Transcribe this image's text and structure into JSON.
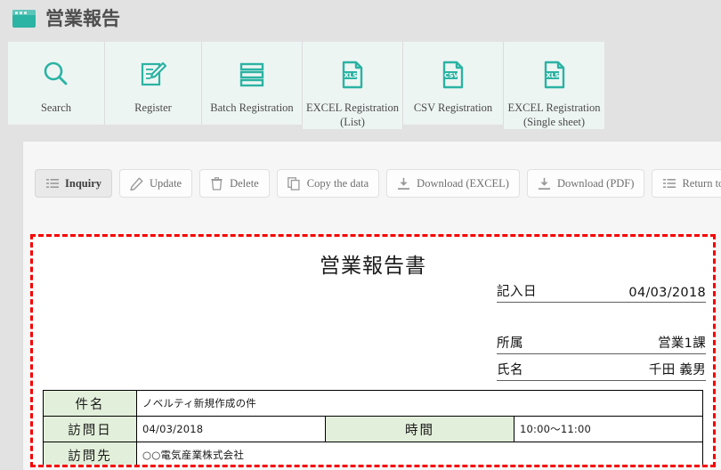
{
  "header": {
    "title": "営業報告",
    "logo_icon": "window-icon",
    "accent_color": "#2bb3a3"
  },
  "tabs": [
    {
      "id": "search",
      "label": "Search",
      "icon": "magnifier-icon",
      "active": false
    },
    {
      "id": "register",
      "label": "Register",
      "icon": "pencil-document-icon",
      "active": false
    },
    {
      "id": "batch-registration",
      "label": "Batch Registration",
      "icon": "stacked-rows-icon",
      "active": false
    },
    {
      "id": "excel-registration-list",
      "label": "EXCEL Registration\n(List)",
      "icon": "xls-file-icon",
      "active": true
    },
    {
      "id": "csv-registration",
      "label": "CSV Registration",
      "icon": "csv-file-icon",
      "active": false
    },
    {
      "id": "excel-registration-single",
      "label": "EXCEL Registration\n(Single sheet)",
      "icon": "xls-file-icon",
      "active": true
    }
  ],
  "actions": [
    {
      "id": "inquiry",
      "label": "Inquiry",
      "icon": "list-icon",
      "active": true
    },
    {
      "id": "update",
      "label": "Update",
      "icon": "pencil-icon",
      "active": false
    },
    {
      "id": "delete",
      "label": "Delete",
      "icon": "trash-icon",
      "active": false
    },
    {
      "id": "copy-the-data",
      "label": "Copy the data",
      "icon": "copy-icon",
      "active": false
    },
    {
      "id": "download-excel",
      "label": "Download (EXCEL)",
      "icon": "download-icon",
      "active": false
    },
    {
      "id": "download-pdf",
      "label": "Download (PDF)",
      "icon": "download-icon",
      "active": false
    },
    {
      "id": "return-to-list",
      "label": "Return to list",
      "icon": "list-icon",
      "active": false
    }
  ],
  "report": {
    "border_color": "#f60000",
    "title": "営業報告書",
    "meta": {
      "date_label": "記入日",
      "date_value": "04/03/2018",
      "dept_label": "所属",
      "dept_value": "営業1課",
      "name_label": "氏名",
      "name_value": "千田 義男"
    },
    "rows": [
      {
        "label": "件名",
        "value": "ノベルティ新規作成の件",
        "label2": "",
        "value2": ""
      },
      {
        "label": "訪問日",
        "value": "04/03/2018",
        "label2": "時間",
        "value2": "10:00〜11:00"
      },
      {
        "label": "訪問先",
        "value": "○○電気産業株式会社",
        "label2": "",
        "value2": ""
      }
    ]
  }
}
